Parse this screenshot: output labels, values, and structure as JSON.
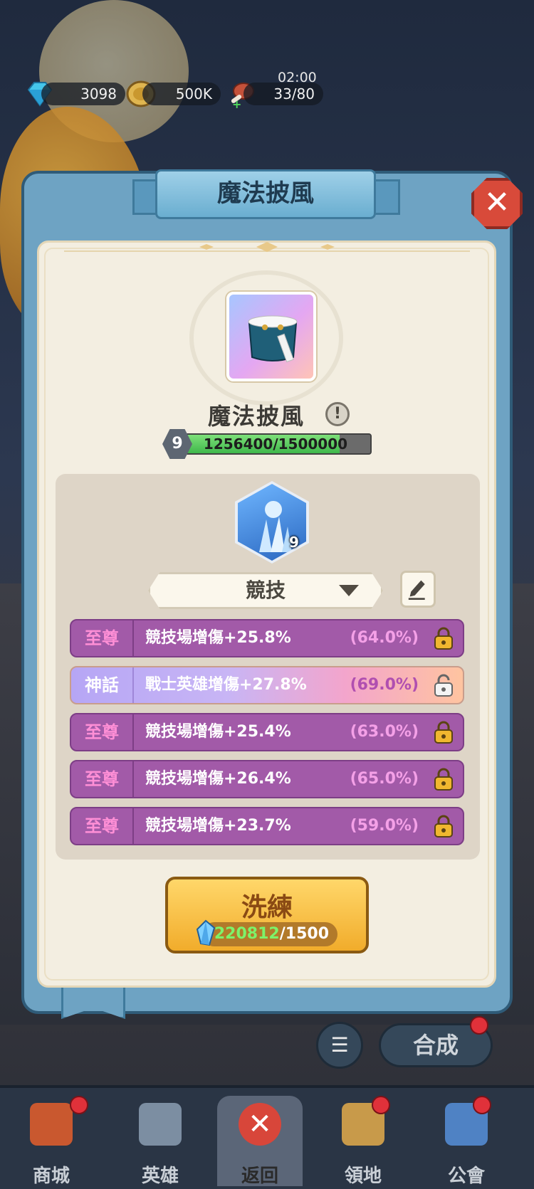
{
  "resources": {
    "gems": "3098",
    "coins": "500K",
    "stamina": "33/80",
    "stamina_timer": "02:00"
  },
  "dialog": {
    "title": "魔法披風",
    "item_name": "魔法披風",
    "level": "9",
    "exp_text": "1256400/1500000",
    "exp_fraction": 0.8376,
    "skill_level": "9",
    "preset_label": "競技",
    "stats": [
      {
        "tier": "至尊",
        "desc": "競技場增傷+25.8%",
        "pct": "(64.0%)",
        "locked": true
      },
      {
        "tier": "神話",
        "desc": "戰士英雄增傷+27.8%",
        "pct": "(69.0%)",
        "locked": false
      },
      {
        "tier": "至尊",
        "desc": "競技場增傷+25.4%",
        "pct": "(63.0%)",
        "locked": true
      },
      {
        "tier": "至尊",
        "desc": "競技場增傷+26.4%",
        "pct": "(65.0%)",
        "locked": true
      },
      {
        "tier": "至尊",
        "desc": "競技場增傷+23.7%",
        "pct": "(59.0%)",
        "locked": true
      }
    ],
    "reforge": {
      "label": "洗練",
      "have": "220812",
      "need": "/1500"
    }
  },
  "bg_buttons": {
    "merge": "合成"
  },
  "nav": [
    {
      "label": "商城",
      "icon": "shop-icon"
    },
    {
      "label": "英雄",
      "icon": "hero-icon"
    },
    {
      "label": "返回",
      "icon": "close-icon"
    },
    {
      "label": "領地",
      "icon": "castle-icon"
    },
    {
      "label": "公會",
      "icon": "guild-planet-icon"
    }
  ],
  "colors": {
    "supreme_row": "#a25aa8",
    "myth_row": "#c8b5f5",
    "button_gold": "#f1ac2b",
    "exp_green": "#3fb84b"
  }
}
